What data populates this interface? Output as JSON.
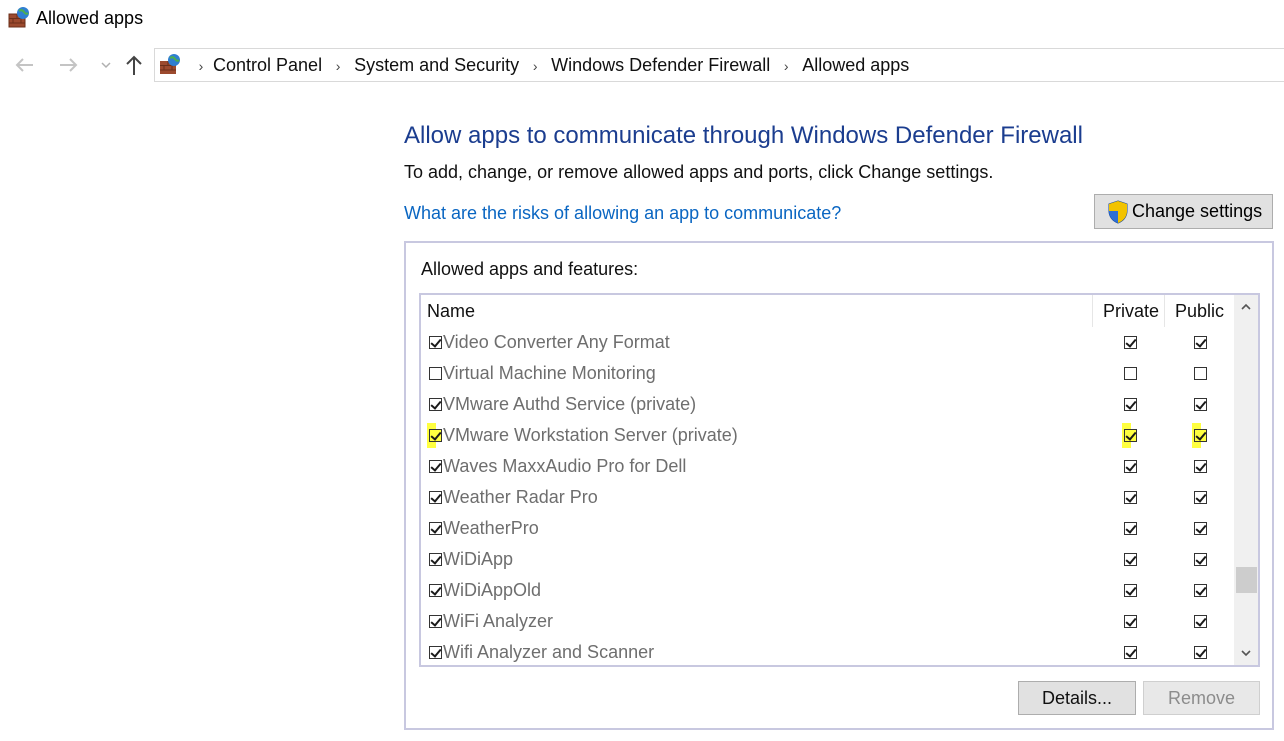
{
  "window": {
    "title": "Allowed apps",
    "icon": "firewall-icon"
  },
  "nav": {
    "back_icon": "back-arrow-icon",
    "forward_icon": "forward-arrow-icon",
    "recent_icon": "chevron-down-icon",
    "up_icon": "up-arrow-icon",
    "breadcrumbs": [
      "Control Panel",
      "System and Security",
      "Windows Defender Firewall",
      "Allowed apps"
    ]
  },
  "main": {
    "heading": "Allow apps to communicate through Windows Defender Firewall",
    "subtext": "To add, change, or remove allowed apps and ports, click Change settings.",
    "risk_link": "What are the risks of allowing an app to communicate?",
    "change_settings_label": "Change settings",
    "group_label": "Allowed apps and features:",
    "columns": {
      "name": "Name",
      "private": "Private",
      "public": "Public"
    },
    "rows": [
      {
        "name": "Video Converter Any Format",
        "enabled": true,
        "private": true,
        "public": true,
        "highlight": false
      },
      {
        "name": "Virtual Machine Monitoring",
        "enabled": false,
        "private": false,
        "public": false,
        "highlight": false
      },
      {
        "name": "VMware Authd Service (private)",
        "enabled": true,
        "private": true,
        "public": true,
        "highlight": false
      },
      {
        "name": "VMware Workstation Server (private)",
        "enabled": true,
        "private": true,
        "public": true,
        "highlight": true
      },
      {
        "name": "Waves MaxxAudio Pro for Dell",
        "enabled": true,
        "private": true,
        "public": true,
        "highlight": false
      },
      {
        "name": "Weather Radar Pro",
        "enabled": true,
        "private": true,
        "public": true,
        "highlight": false
      },
      {
        "name": "WeatherPro",
        "enabled": true,
        "private": true,
        "public": true,
        "highlight": false
      },
      {
        "name": "WiDiApp",
        "enabled": true,
        "private": true,
        "public": true,
        "highlight": false
      },
      {
        "name": "WiDiAppOld",
        "enabled": true,
        "private": true,
        "public": true,
        "highlight": false
      },
      {
        "name": "WiFi Analyzer",
        "enabled": true,
        "private": true,
        "public": true,
        "highlight": false
      },
      {
        "name": "Wifi Analyzer and Scanner",
        "enabled": true,
        "private": true,
        "public": true,
        "highlight": false
      }
    ],
    "details_label": "Details...",
    "remove_label": "Remove"
  },
  "colors": {
    "heading": "#1b3d8f",
    "link": "#0a66c2",
    "highlight": "#ffff40",
    "row_text": "#6e6e6e"
  }
}
